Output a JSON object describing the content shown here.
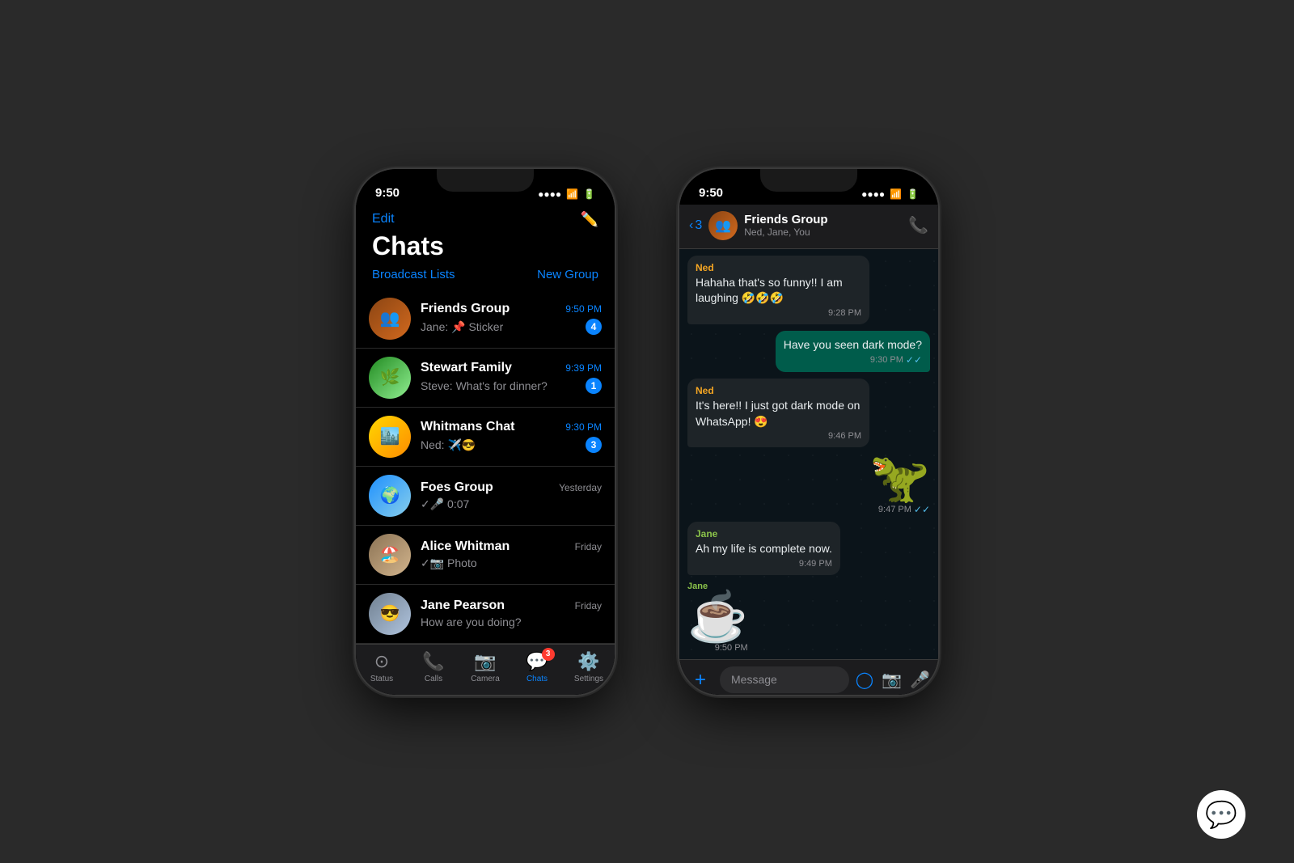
{
  "background": "#2a2a2a",
  "phone1": {
    "status_bar": {
      "time": "9:50",
      "signal": "●●●●",
      "wifi": "wifi",
      "battery": "battery"
    },
    "header": {
      "edit_label": "Edit",
      "title": "Chats",
      "broadcast_lists": "Broadcast Lists",
      "new_group": "New Group"
    },
    "chats": [
      {
        "name": "Friends Group",
        "time": "9:50 PM",
        "preview": "Jane: 📌 Sticker",
        "unread": "4",
        "is_blue_time": true
      },
      {
        "name": "Stewart Family",
        "time": "9:39 PM",
        "preview": "Steve: What's for dinner?",
        "unread": "1",
        "is_blue_time": true
      },
      {
        "name": "Whitmans Chat",
        "time": "9:30 PM",
        "preview": "Ned: ✈️😎",
        "unread": "3",
        "is_blue_time": true
      },
      {
        "name": "Foes Group",
        "time": "Yesterday",
        "preview": "✓🎤 0:07",
        "unread": "",
        "is_blue_time": false
      },
      {
        "name": "Alice Whitman",
        "time": "Friday",
        "preview": "✓📷 Photo",
        "unread": "",
        "is_blue_time": false
      },
      {
        "name": "Jane Pearson",
        "time": "Friday",
        "preview": "How are you doing?",
        "unread": "",
        "is_blue_time": false
      }
    ],
    "tab_bar": {
      "items": [
        {
          "label": "Status",
          "icon": "○",
          "active": false
        },
        {
          "label": "Calls",
          "icon": "☎",
          "active": false
        },
        {
          "label": "Camera",
          "icon": "⊙",
          "active": false
        },
        {
          "label": "Chats",
          "icon": "💬",
          "active": true,
          "badge": "3"
        },
        {
          "label": "Settings",
          "icon": "⚙",
          "active": false
        }
      ]
    }
  },
  "phone2": {
    "status_bar": {
      "time": "9:50"
    },
    "header": {
      "back_count": "3",
      "group_name": "Friends Group",
      "members": "Ned, Jane, You"
    },
    "messages": [
      {
        "type": "received",
        "sender": "Ned",
        "sender_color": "orange",
        "text": "Hahaha that's so funny!! I am laughing 🤣🤣🤣",
        "time": "9:28 PM",
        "ticks": ""
      },
      {
        "type": "sent",
        "sender": "",
        "text": "Have you seen dark mode?",
        "time": "9:30 PM",
        "ticks": "✓✓"
      },
      {
        "type": "received",
        "sender": "Ned",
        "sender_color": "orange",
        "text": "It's here!! I just got dark mode on WhatsApp! 😍",
        "time": "9:46 PM",
        "ticks": ""
      },
      {
        "type": "sent-sticker",
        "text": "🦖",
        "time": "9:47 PM",
        "ticks": "✓✓"
      },
      {
        "type": "received",
        "sender": "Jane",
        "sender_color": "green",
        "text": "Ah my life is complete now.",
        "time": "9:49 PM",
        "ticks": ""
      },
      {
        "type": "received-sticker",
        "sender": "Jane",
        "text": "☕",
        "time": "9:50 PM",
        "ticks": ""
      }
    ],
    "input_placeholder": "Message"
  },
  "whatsapp_logo": "💬"
}
